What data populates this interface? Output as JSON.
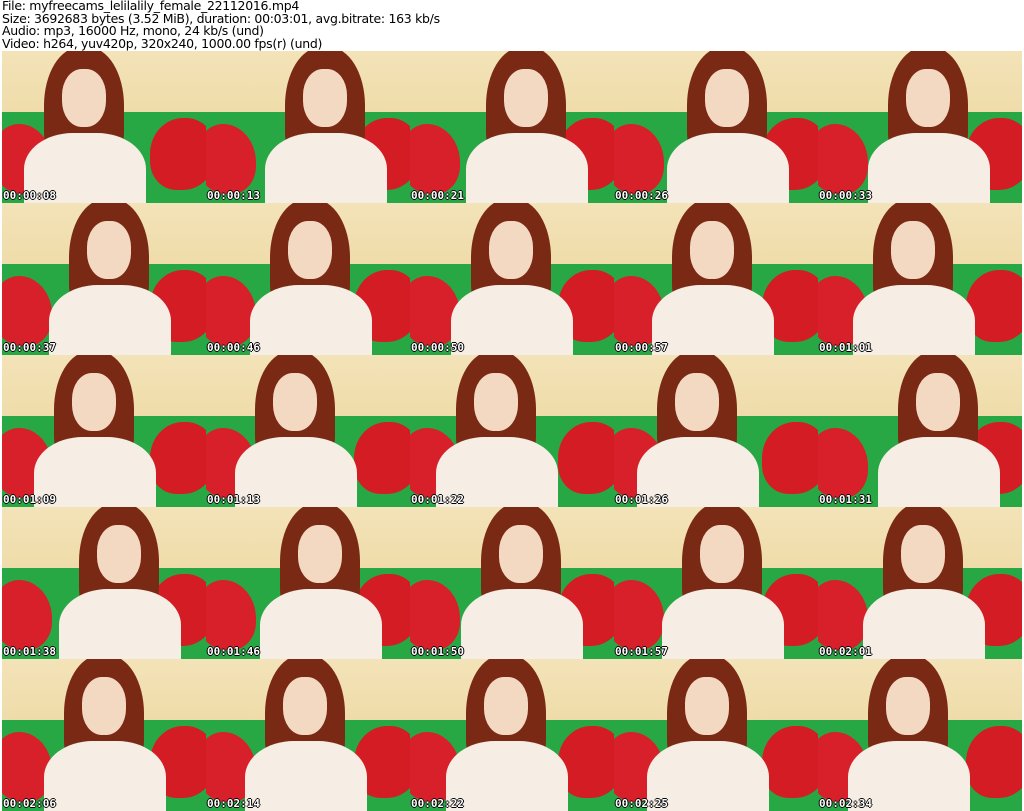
{
  "header": {
    "file": "File: myfreecams_lelilalily_female_22112016.mp4",
    "size": "Size: 3692683 bytes (3.52 MiB), duration: 00:03:01, avg.bitrate: 163 kb/s",
    "audio": "Audio: mp3, 16000 Hz, mono, 24 kb/s (und)",
    "video": "Video: h264, yuv420p, 320x240, 1000.00 fps(r) (und)"
  },
  "thumbnails": [
    {
      "timestamp": "00:00:08"
    },
    {
      "timestamp": "00:00:13"
    },
    {
      "timestamp": "00:00:21"
    },
    {
      "timestamp": "00:00:26"
    },
    {
      "timestamp": "00:00:33"
    },
    {
      "timestamp": "00:00:37"
    },
    {
      "timestamp": "00:00:46"
    },
    {
      "timestamp": "00:00:50"
    },
    {
      "timestamp": "00:00:57"
    },
    {
      "timestamp": "00:01:01"
    },
    {
      "timestamp": "00:01:09"
    },
    {
      "timestamp": "00:01:13"
    },
    {
      "timestamp": "00:01:22"
    },
    {
      "timestamp": "00:01:26"
    },
    {
      "timestamp": "00:01:31"
    },
    {
      "timestamp": "00:01:38"
    },
    {
      "timestamp": "00:01:46"
    },
    {
      "timestamp": "00:01:50"
    },
    {
      "timestamp": "00:01:57"
    },
    {
      "timestamp": "00:02:01"
    },
    {
      "timestamp": "00:02:06"
    },
    {
      "timestamp": "00:02:14"
    },
    {
      "timestamp": "00:02:22"
    },
    {
      "timestamp": "00:02:25"
    },
    {
      "timestamp": "00:02:34"
    }
  ]
}
